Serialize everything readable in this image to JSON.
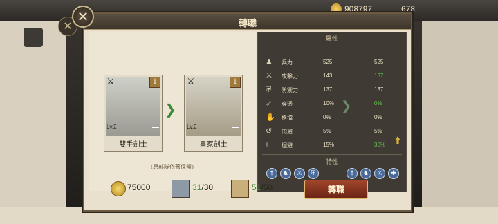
{
  "background": {
    "resource_amount": "908797",
    "resource_amount2": "678"
  },
  "dialog": {
    "title": "轉職",
    "close_symbol": "✕"
  },
  "cards": {
    "from": {
      "name": "雙手劍士",
      "level": "Lv.2",
      "info": "i"
    },
    "to": {
      "name": "皇家劍士",
      "level": "Lv.2",
      "info": "i"
    }
  },
  "note": "(原部隊依舊保留)",
  "attributes": {
    "title": "屬性",
    "rows": [
      {
        "icon": "soldiers-icon",
        "label": "兵力",
        "before": "525",
        "after": "525",
        "up": false
      },
      {
        "icon": "attack-icon",
        "label": "攻擊力",
        "before": "143",
        "after": "137",
        "up": true
      },
      {
        "icon": "defense-icon",
        "label": "防禦力",
        "before": "137",
        "after": "137",
        "up": false
      },
      {
        "icon": "pierce-icon",
        "label": "穿透",
        "before": "10%",
        "after": "0%",
        "up": true
      },
      {
        "icon": "block-icon",
        "label": "格擋",
        "before": "0%",
        "after": "0%",
        "up": false
      },
      {
        "icon": "dodge-icon",
        "label": "閃避",
        "before": "5%",
        "after": "5%",
        "up": false
      },
      {
        "icon": "counter-icon",
        "label": "迴避",
        "before": "15%",
        "after": "30%",
        "up": true
      }
    ]
  },
  "traits": {
    "title": "特性"
  },
  "cost": {
    "gold": "75000",
    "units_have": "31",
    "units_need": "/30",
    "scrolls_have": "51",
    "scrolls_need": "/50"
  },
  "action": {
    "label": "轉職"
  }
}
